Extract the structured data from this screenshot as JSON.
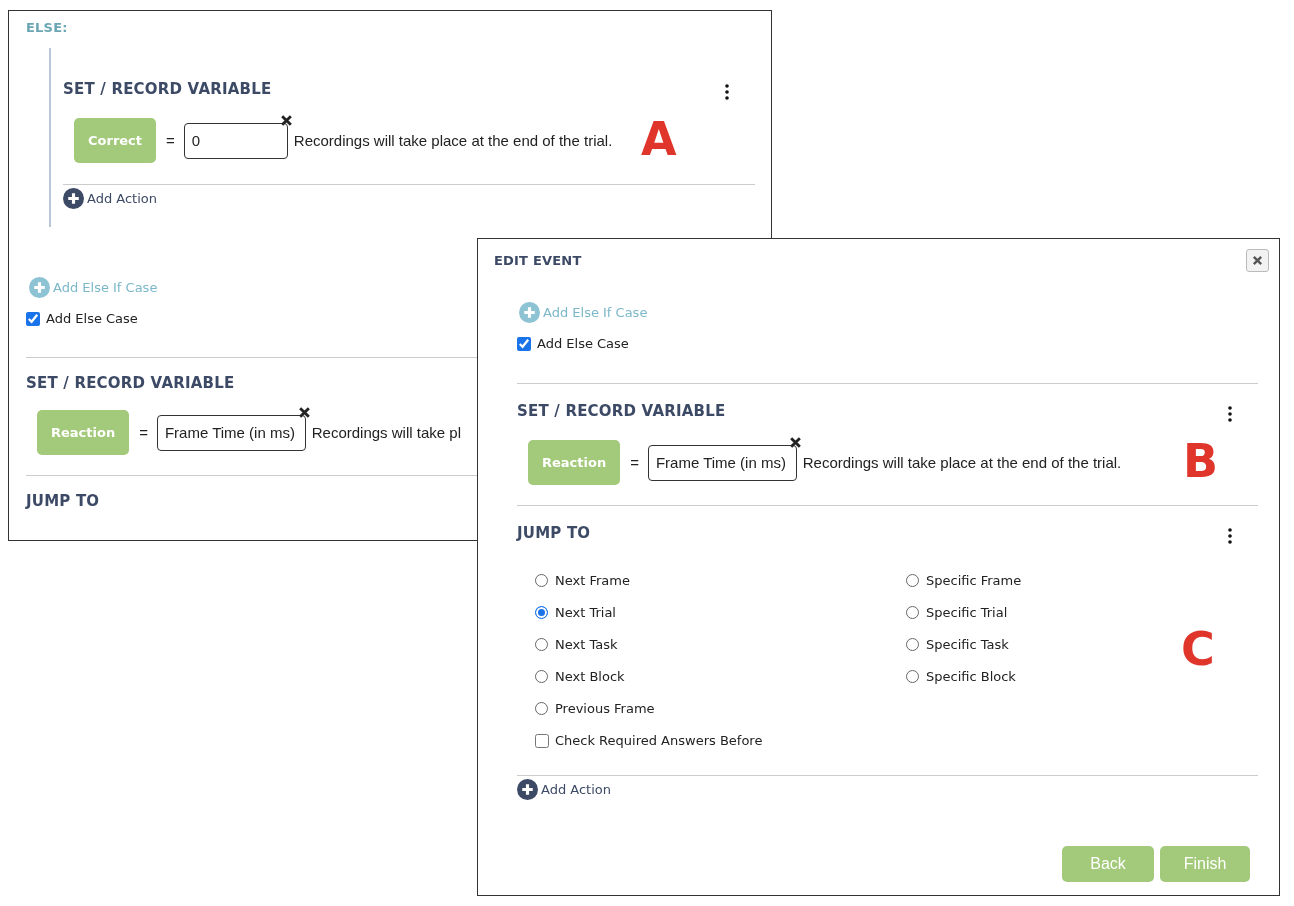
{
  "else_panel": {
    "else_label": "ELSE:",
    "nested_action": {
      "title": "SET / RECORD VARIABLE",
      "variable": "Correct",
      "equals": "=",
      "value": "0",
      "note": "Recordings will take place at the end of the trial.",
      "annotation": "A"
    },
    "add_action": "Add Action",
    "add_else_if": "Add Else If Case",
    "add_else": {
      "label": "Add Else Case",
      "checked": true
    },
    "set_variable": {
      "title": "SET / RECORD VARIABLE",
      "variable": "Reaction",
      "equals": "=",
      "value": "Frame Time (in ms)",
      "note": "Recordings will take pl"
    },
    "jump_to": {
      "title": "JUMP TO"
    }
  },
  "edit_event": {
    "title": "EDIT EVENT",
    "add_else_if": "Add Else If Case",
    "add_else": {
      "label": "Add Else Case",
      "checked": true
    },
    "set_variable": {
      "title": "SET / RECORD VARIABLE",
      "variable": "Reaction",
      "equals": "=",
      "value": "Frame Time (in ms)",
      "note": "Recordings will take place at the end of the trial.",
      "annotation": "B"
    },
    "jump_to": {
      "title": "JUMP TO",
      "annotation": "C",
      "options": [
        {
          "label": "Next Frame",
          "selected": false
        },
        {
          "label": "Next Trial",
          "selected": true
        },
        {
          "label": "Next Task",
          "selected": false
        },
        {
          "label": "Next Block",
          "selected": false
        },
        {
          "label": "Previous Frame",
          "selected": false
        },
        {
          "label": "Specific Frame",
          "selected": false
        },
        {
          "label": "Specific Trial",
          "selected": false
        },
        {
          "label": "Specific Task",
          "selected": false
        },
        {
          "label": "Specific Block",
          "selected": false
        }
      ],
      "check_required": {
        "label": "Check Required Answers Before",
        "checked": false
      }
    },
    "add_action": "Add Action",
    "buttons": [
      "Back",
      "Finish"
    ]
  }
}
